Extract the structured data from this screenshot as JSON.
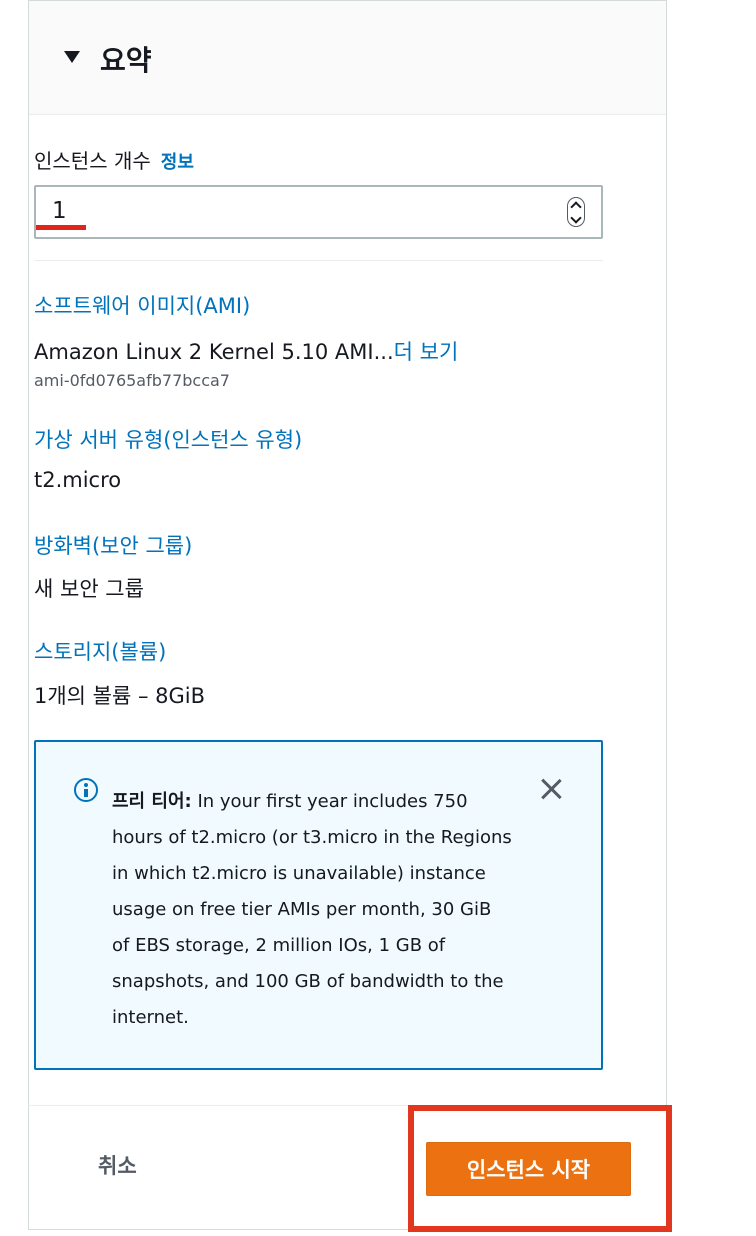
{
  "header": {
    "title": "요약"
  },
  "instance_count": {
    "label": "인스턴스 개수",
    "info_link": "정보",
    "value": "1"
  },
  "sections": {
    "ami": {
      "title": "소프트웨어 이미지(AMI)",
      "value": "Amazon Linux 2 Kernel 5.10 AMI...",
      "more_link": "더 보기",
      "id": "ami-0fd0765afb77bcca7"
    },
    "instance_type": {
      "title": "가상 서버 유형(인스턴스 유형)",
      "value": "t2.micro"
    },
    "firewall": {
      "title": "방화벽(보안 그룹)",
      "value": "새 보안 그룹"
    },
    "storage": {
      "title": "스토리지(볼륨)",
      "value": "1개의 볼륨 – 8GiB"
    }
  },
  "free_tier_notice": {
    "label": "프리 티어:",
    "text": "In your first year includes 750 hours of t2.micro (or t3.micro in the Regions in which t2.micro is unavailable) instance usage on free tier AMIs per month, 30 GiB of EBS storage, 2 million IOs, 1 GB of snapshots, and 100 GB of bandwidth to the internet."
  },
  "footer": {
    "cancel_label": "취소",
    "launch_label": "인스턴스 시작"
  },
  "colors": {
    "link": "#0073bb",
    "primary_button": "#ec7211",
    "notice_bg": "#f1faff",
    "annotation_red": "#e2371f"
  }
}
